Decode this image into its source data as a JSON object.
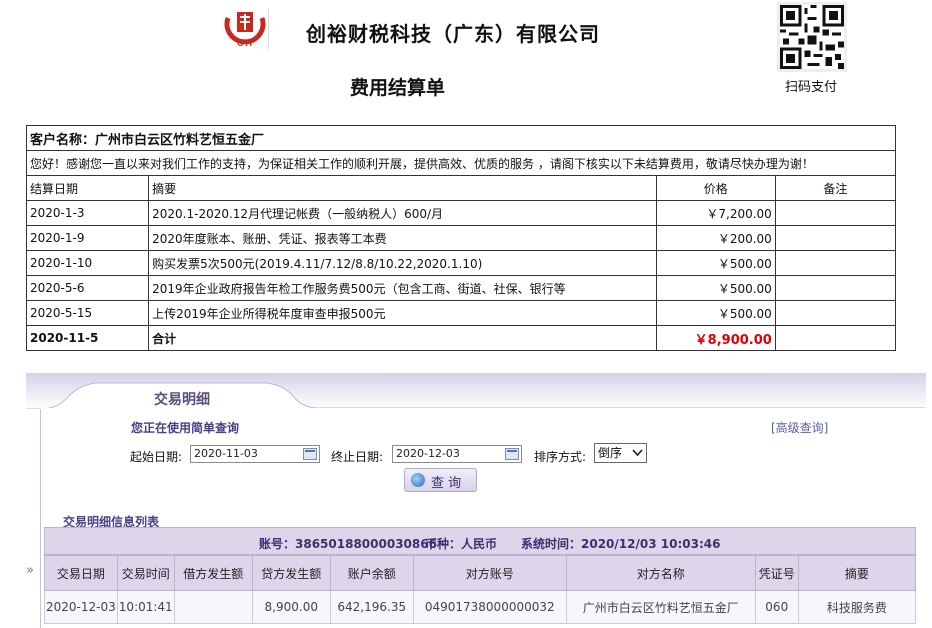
{
  "header": {
    "company": "创裕财税科技（广东）有限公司",
    "doc_title": "费用结算单",
    "qr_label": "扫码支付"
  },
  "bill": {
    "customer": "客户名称：广州市白云区竹料艺恒五金厂",
    "greeting": "您好！感谢您一直以来对我们工作的支持，为保证相关工作的顺利开展，提供高效、优质的服务 ，请阁下核实以下未结算费用，敬请尽快办理为谢！",
    "columns": [
      "结算日期",
      "摘要",
      "价格",
      "备注"
    ],
    "rows": [
      {
        "date": "2020-1-3",
        "summary": "2020.1-2020.12月代理记帐费（一般纳税人）600/月",
        "price": "￥7,200.00",
        "note": ""
      },
      {
        "date": "2020-1-9",
        "summary": "2020年度账本、账册、凭证、报表等工本费",
        "price": "￥200.00",
        "note": ""
      },
      {
        "date": "2020-1-10",
        "summary": "购买发票5次500元(2019.4.11/7.12/8.8/10.22,2020.1.10)",
        "price": "￥500.00",
        "note": ""
      },
      {
        "date": "2020-5-6",
        "summary": "2019年企业政府报告年检工作服务费500元（包含工商、街道、社保、银行等",
        "price": "￥500.00",
        "note": ""
      },
      {
        "date": "2020-5-15",
        "summary": "上传2019年企业所得税年度审查申报500元",
        "price": "￥500.00",
        "note": ""
      }
    ],
    "total": {
      "date": "2020-11-5",
      "label": "合计",
      "price": "￥8,900.00"
    }
  },
  "bank": {
    "tab": "交易明细",
    "mode": "您正在使用简单查询",
    "advanced": "[高级查询]",
    "start_label": "起始日期:",
    "start_value": "2020-11-03",
    "end_label": "终止日期:",
    "end_value": "2020-12-03",
    "sort_label": "排序方式:",
    "sort_value": "倒序",
    "query_btn": "查 询",
    "list_title": "交易明细信息列表",
    "account": "账号：38650188000030866",
    "currency": "币种：人民币",
    "systime": "系统时间：2020/12/03  10:03:46",
    "side_arrow": "»",
    "columns": [
      "交易日期",
      "交易时间",
      "借方发生额",
      "贷方发生额",
      "账户余额",
      "对方账号",
      "对方名称",
      "凭证号",
      "摘要"
    ],
    "rows": [
      [
        "2020-12-03",
        "10:01:41",
        "",
        "8,900.00",
        "642,196.35",
        "04901738000000032",
        "广州市白云区竹料艺恒五金厂",
        "060",
        "科技服务费"
      ]
    ]
  },
  "colors": {
    "accent": "#5c4b80",
    "header_bg": "#ddd6ea",
    "total_red": "#e00000",
    "logo_red": "#c8281e"
  }
}
